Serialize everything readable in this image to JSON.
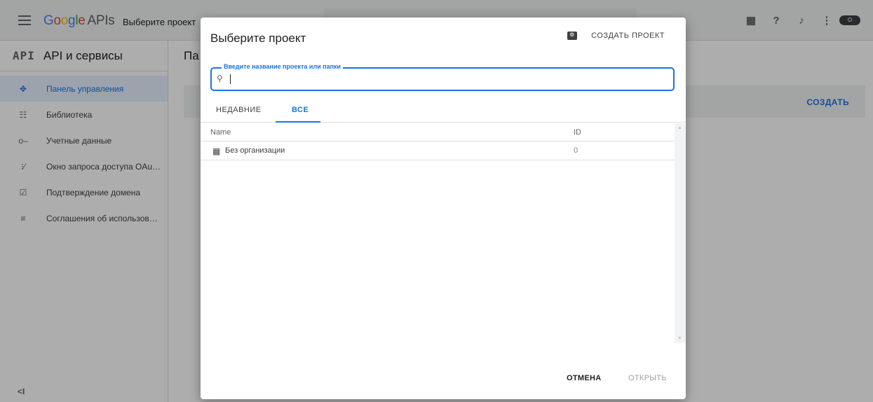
{
  "topbar": {
    "logo_google": [
      "G",
      "o",
      "o",
      "g",
      "l",
      "e"
    ],
    "logo_apis": "APIs",
    "project_selector": "Выберите проект",
    "avatar_text": "O"
  },
  "sidebar": {
    "badge": "API",
    "title": "API и сервисы",
    "items": [
      {
        "label": "Панель управления",
        "icon": "dashboard-icon"
      },
      {
        "label": "Библиотека",
        "icon": "library-icon"
      },
      {
        "label": "Учетные данные",
        "icon": "key-icon"
      },
      {
        "label": "Окно запроса доступа OAu…",
        "icon": "oauth-consent-icon"
      },
      {
        "label": "Подтверждение домена",
        "icon": "domain-check-icon"
      },
      {
        "label": "Соглашения об использов…",
        "icon": "agreements-icon"
      }
    ],
    "collapse_label": "<I"
  },
  "main": {
    "title": "Па",
    "create_link": "СОЗДАТЬ"
  },
  "dialog": {
    "title": "Выберите проект",
    "create_project": "СОЗДАТЬ ПРОЕКТ",
    "search": {
      "label": "Введите название проекта или папки",
      "value": ""
    },
    "tabs": [
      {
        "label": "НЕДАВНИЕ",
        "active": false
      },
      {
        "label": "ВСЕ",
        "active": true
      }
    ],
    "table": {
      "columns": [
        "Name",
        "ID"
      ],
      "rows": [
        {
          "name": "Без организации",
          "id": "0",
          "icon": "organization-icon"
        }
      ]
    },
    "cancel_label": "ОТМЕНА",
    "open_label": "ОТКРЫТЬ"
  },
  "colors": {
    "accent": "#1a73e8",
    "overlay": "rgba(0,0,0,0.32)"
  }
}
